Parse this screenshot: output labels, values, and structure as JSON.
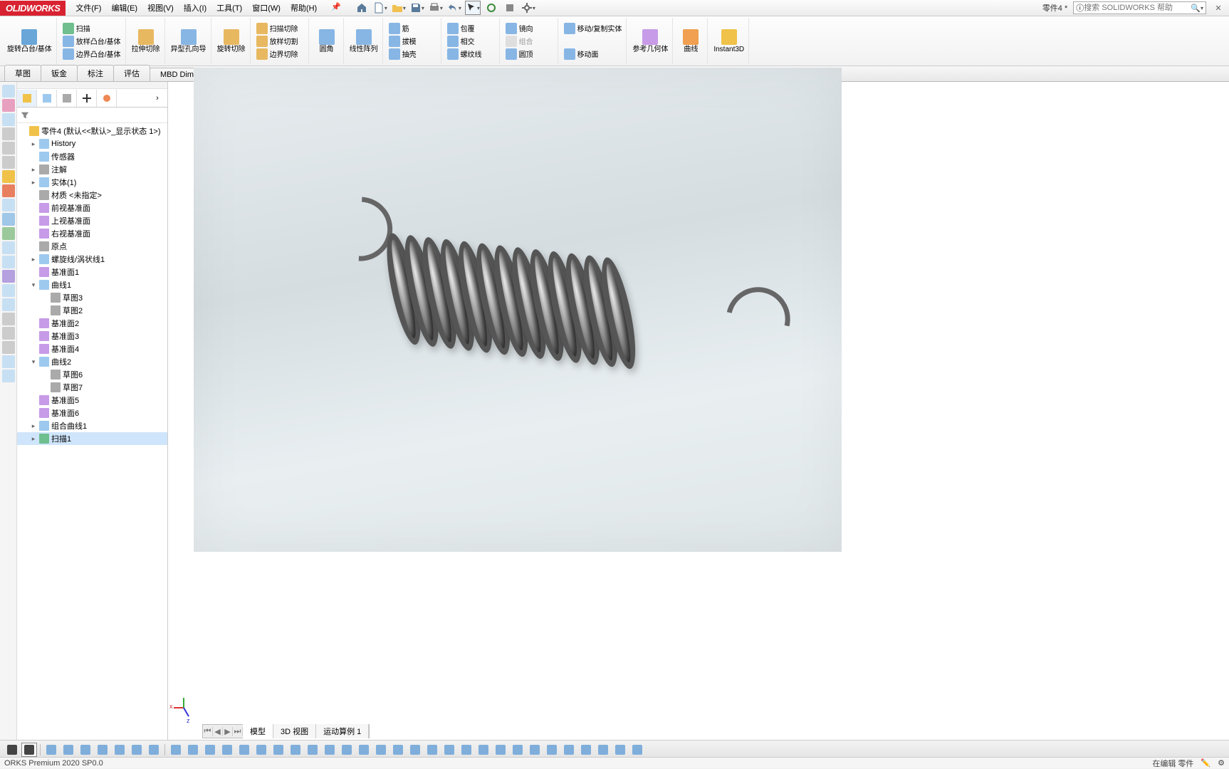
{
  "app": {
    "logo": "OLIDWORKS"
  },
  "menu": {
    "file": "文件(F)",
    "edit": "编辑(E)",
    "view": "视图(V)",
    "insert": "插入(I)",
    "tools": "工具(T)",
    "window": "窗口(W)",
    "help": "帮助(H)"
  },
  "title": {
    "doc": "零件4 *"
  },
  "search": {
    "placeholder": "搜索 SOLIDWORKS 帮助"
  },
  "ribbon": {
    "g1a": "旋转凸台/基体",
    "g1b": "扫描",
    "g1c": "放样凸台/基体",
    "g1d": "边界凸台/基体",
    "g2a": "拉伸切除",
    "g2b": "异型孔向导",
    "g2c": "旋转切除",
    "g2d": "扫描切除",
    "g2e": "放样切割",
    "g2f": "边界切除",
    "g3a": "圆角",
    "g3b": "线性阵列",
    "g3c": "筋",
    "g3d": "包覆",
    "g3e": "拔模",
    "g3f": "相交",
    "g3g": "抽壳",
    "g3h": "螺纹线",
    "g3i": "镜向",
    "g3j": "组合",
    "g3k": "圆顶",
    "g4a": "移动/复制实体",
    "g4b": "移动面",
    "g5a": "参考几何体",
    "g5b": "曲线",
    "g5c": "Instant3D"
  },
  "cmtabs": {
    "t1": "草图",
    "t2": "钣金",
    "t3": "标注",
    "t4": "评估",
    "t5": "MBD Dimensions"
  },
  "tree": {
    "root": "零件4 (默认<<默认>_显示状态 1>)",
    "history": "History",
    "sensors": "传感器",
    "annot": "注解",
    "solid": "实体(1)",
    "material": "材质 <未指定>",
    "front": "前视基准面",
    "top": "上视基准面",
    "right": "右视基准面",
    "origin": "原点",
    "helix": "螺旋线/涡状线1",
    "plane1": "基准面1",
    "curve1": "曲线1",
    "sk3": "草图3",
    "sk2": "草图2",
    "plane2": "基准面2",
    "plane3": "基准面3",
    "plane4": "基准面4",
    "curve2": "曲线2",
    "sk6": "草图6",
    "sk7": "草图7",
    "plane5": "基准面5",
    "plane6": "基准面6",
    "compcurve": "组合曲线1",
    "sweep": "扫描1"
  },
  "btabs": {
    "t1": "模型",
    "t2": "3D 视图",
    "t3": "运动算例 1"
  },
  "status": {
    "left": "ORKS Premium 2020 SP0.0",
    "right": "在编辑 零件"
  },
  "triad": {
    "x": "x",
    "z": "z"
  }
}
